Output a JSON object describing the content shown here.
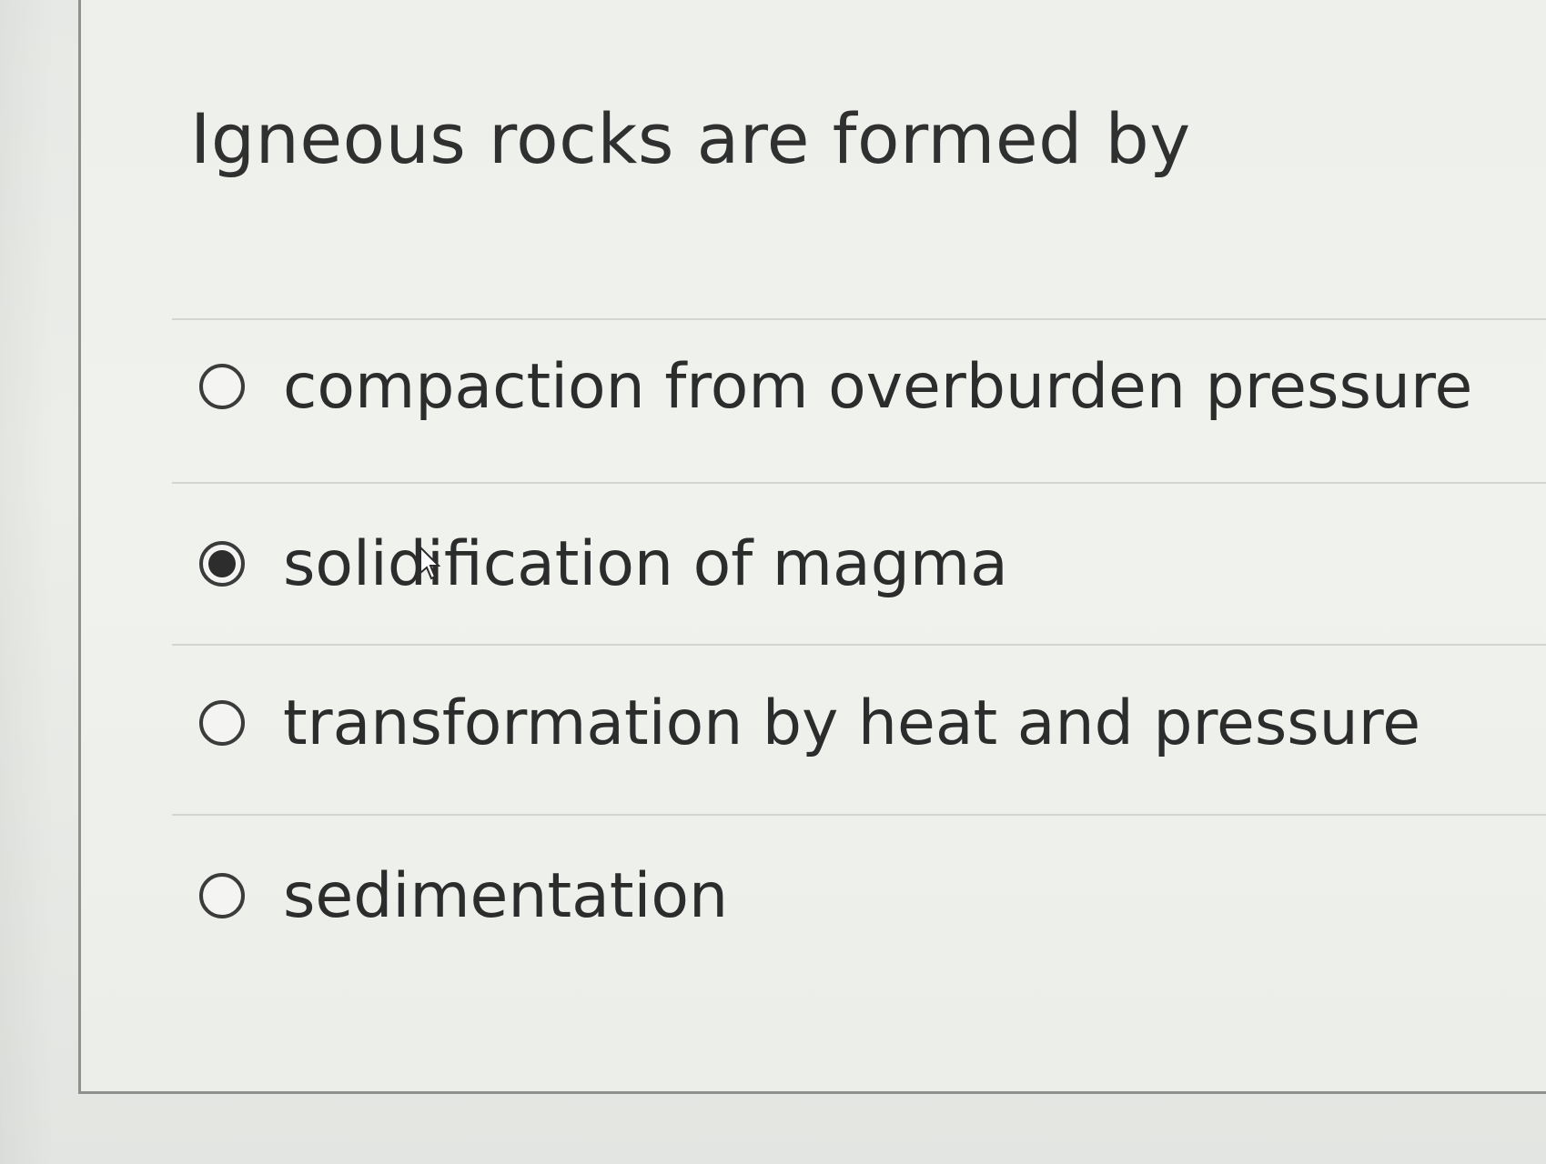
{
  "question": {
    "text": "Igneous rocks are formed by"
  },
  "answers": [
    {
      "label": "compaction from overburden pressure",
      "selected": false
    },
    {
      "label": "solidification of magma",
      "selected": true
    },
    {
      "label": "transformation by heat and pressure",
      "selected": false
    },
    {
      "label": "sedimentation",
      "selected": false
    }
  ],
  "icons": {
    "radio": "radio-button-icon",
    "cursor": "mouse-pointer-icon"
  },
  "colors": {
    "text": "#2b2c2b",
    "radio": "#3a3b3a",
    "divider": "#d3d5d1"
  }
}
